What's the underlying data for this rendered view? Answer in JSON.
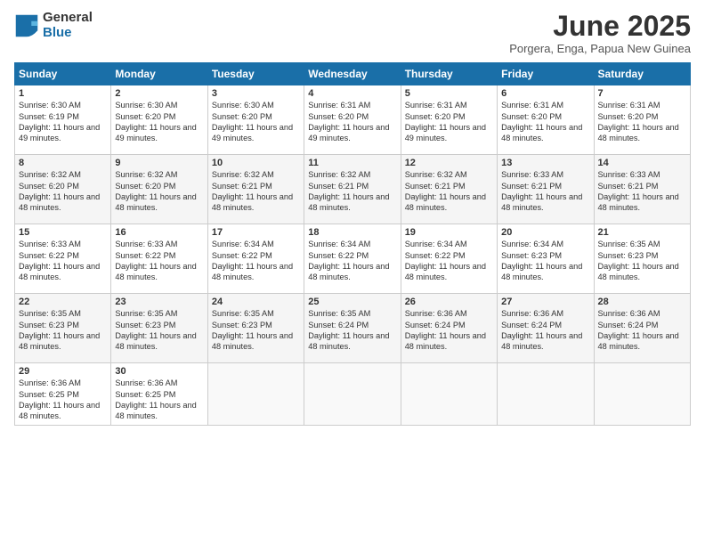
{
  "logo": {
    "general": "General",
    "blue": "Blue"
  },
  "title": "June 2025",
  "subtitle": "Porgera, Enga, Papua New Guinea",
  "days_header": [
    "Sunday",
    "Monday",
    "Tuesday",
    "Wednesday",
    "Thursday",
    "Friday",
    "Saturday"
  ],
  "weeks": [
    [
      {
        "num": "1",
        "sunrise": "6:30 AM",
        "sunset": "6:19 PM",
        "daylight": "11 hours and 49 minutes."
      },
      {
        "num": "2",
        "sunrise": "6:30 AM",
        "sunset": "6:20 PM",
        "daylight": "11 hours and 49 minutes."
      },
      {
        "num": "3",
        "sunrise": "6:30 AM",
        "sunset": "6:20 PM",
        "daylight": "11 hours and 49 minutes."
      },
      {
        "num": "4",
        "sunrise": "6:31 AM",
        "sunset": "6:20 PM",
        "daylight": "11 hours and 49 minutes."
      },
      {
        "num": "5",
        "sunrise": "6:31 AM",
        "sunset": "6:20 PM",
        "daylight": "11 hours and 49 minutes."
      },
      {
        "num": "6",
        "sunrise": "6:31 AM",
        "sunset": "6:20 PM",
        "daylight": "11 hours and 48 minutes."
      },
      {
        "num": "7",
        "sunrise": "6:31 AM",
        "sunset": "6:20 PM",
        "daylight": "11 hours and 48 minutes."
      }
    ],
    [
      {
        "num": "8",
        "sunrise": "6:32 AM",
        "sunset": "6:20 PM",
        "daylight": "11 hours and 48 minutes."
      },
      {
        "num": "9",
        "sunrise": "6:32 AM",
        "sunset": "6:20 PM",
        "daylight": "11 hours and 48 minutes."
      },
      {
        "num": "10",
        "sunrise": "6:32 AM",
        "sunset": "6:21 PM",
        "daylight": "11 hours and 48 minutes."
      },
      {
        "num": "11",
        "sunrise": "6:32 AM",
        "sunset": "6:21 PM",
        "daylight": "11 hours and 48 minutes."
      },
      {
        "num": "12",
        "sunrise": "6:32 AM",
        "sunset": "6:21 PM",
        "daylight": "11 hours and 48 minutes."
      },
      {
        "num": "13",
        "sunrise": "6:33 AM",
        "sunset": "6:21 PM",
        "daylight": "11 hours and 48 minutes."
      },
      {
        "num": "14",
        "sunrise": "6:33 AM",
        "sunset": "6:21 PM",
        "daylight": "11 hours and 48 minutes."
      }
    ],
    [
      {
        "num": "15",
        "sunrise": "6:33 AM",
        "sunset": "6:22 PM",
        "daylight": "11 hours and 48 minutes."
      },
      {
        "num": "16",
        "sunrise": "6:33 AM",
        "sunset": "6:22 PM",
        "daylight": "11 hours and 48 minutes."
      },
      {
        "num": "17",
        "sunrise": "6:34 AM",
        "sunset": "6:22 PM",
        "daylight": "11 hours and 48 minutes."
      },
      {
        "num": "18",
        "sunrise": "6:34 AM",
        "sunset": "6:22 PM",
        "daylight": "11 hours and 48 minutes."
      },
      {
        "num": "19",
        "sunrise": "6:34 AM",
        "sunset": "6:22 PM",
        "daylight": "11 hours and 48 minutes."
      },
      {
        "num": "20",
        "sunrise": "6:34 AM",
        "sunset": "6:23 PM",
        "daylight": "11 hours and 48 minutes."
      },
      {
        "num": "21",
        "sunrise": "6:35 AM",
        "sunset": "6:23 PM",
        "daylight": "11 hours and 48 minutes."
      }
    ],
    [
      {
        "num": "22",
        "sunrise": "6:35 AM",
        "sunset": "6:23 PM",
        "daylight": "11 hours and 48 minutes."
      },
      {
        "num": "23",
        "sunrise": "6:35 AM",
        "sunset": "6:23 PM",
        "daylight": "11 hours and 48 minutes."
      },
      {
        "num": "24",
        "sunrise": "6:35 AM",
        "sunset": "6:23 PM",
        "daylight": "11 hours and 48 minutes."
      },
      {
        "num": "25",
        "sunrise": "6:35 AM",
        "sunset": "6:24 PM",
        "daylight": "11 hours and 48 minutes."
      },
      {
        "num": "26",
        "sunrise": "6:36 AM",
        "sunset": "6:24 PM",
        "daylight": "11 hours and 48 minutes."
      },
      {
        "num": "27",
        "sunrise": "6:36 AM",
        "sunset": "6:24 PM",
        "daylight": "11 hours and 48 minutes."
      },
      {
        "num": "28",
        "sunrise": "6:36 AM",
        "sunset": "6:24 PM",
        "daylight": "11 hours and 48 minutes."
      }
    ],
    [
      {
        "num": "29",
        "sunrise": "6:36 AM",
        "sunset": "6:25 PM",
        "daylight": "11 hours and 48 minutes."
      },
      {
        "num": "30",
        "sunrise": "6:36 AM",
        "sunset": "6:25 PM",
        "daylight": "11 hours and 48 minutes."
      },
      null,
      null,
      null,
      null,
      null
    ]
  ]
}
